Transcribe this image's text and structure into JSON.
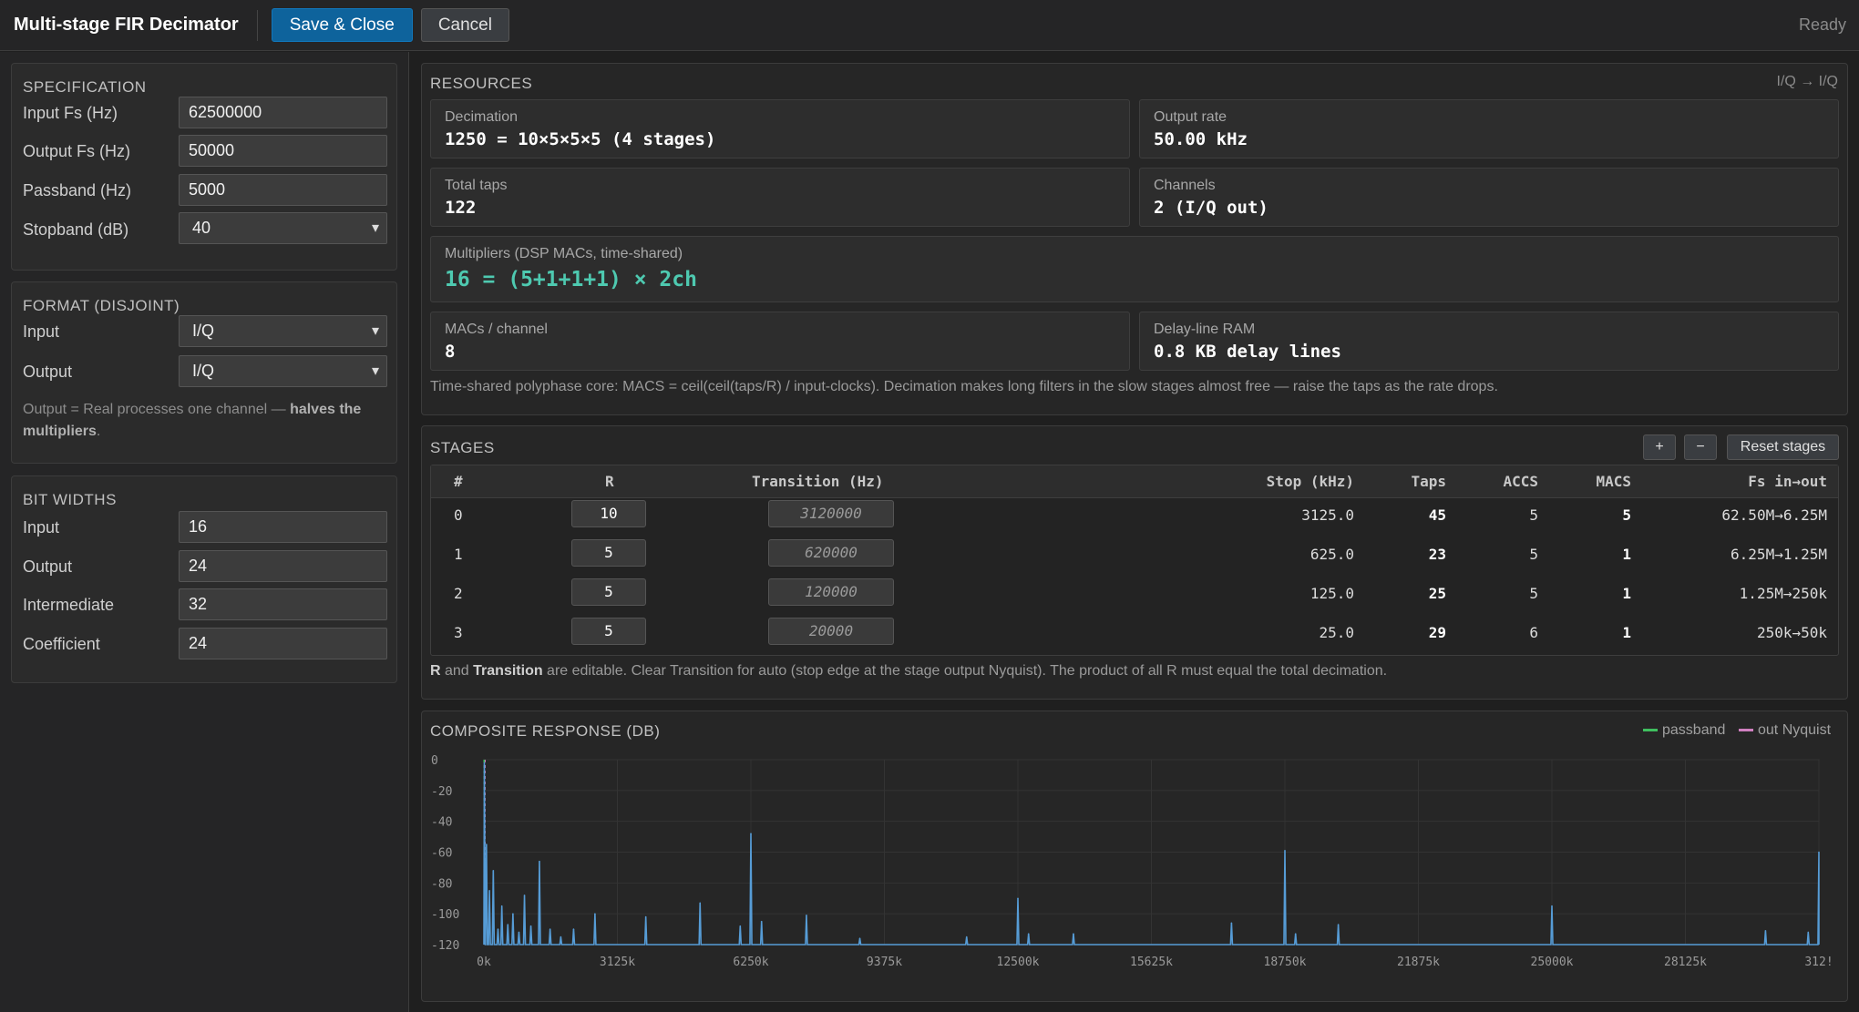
{
  "app": {
    "title": "Multi-stage FIR Decimator",
    "save_label": "Save & Close",
    "cancel_label": "Cancel",
    "status": "Ready"
  },
  "specification": {
    "title": "SPECIFICATION",
    "rows": [
      {
        "label": "Input Fs (Hz)",
        "value": "62500000"
      },
      {
        "label": "Output Fs (Hz)",
        "value": "50000"
      },
      {
        "label": "Passband (Hz)",
        "value": "5000"
      },
      {
        "label": "Stopband (dB)",
        "value": "40"
      }
    ]
  },
  "format": {
    "title": "FORMAT (DISJOINT)",
    "input_label": "Input",
    "input_value": "I/Q",
    "output_label": "Output",
    "output_value": "I/Q",
    "note_a": "Output = Real processes one channel — ",
    "note_b": "halves the multipliers",
    "note_c": "."
  },
  "bitwidths": {
    "title": "BIT WIDTHS",
    "rows": [
      {
        "label": "Input",
        "value": "16"
      },
      {
        "label": "Output",
        "value": "24"
      },
      {
        "label": "Intermediate",
        "value": "32"
      },
      {
        "label": "Coefficient",
        "value": "24"
      }
    ]
  },
  "resources": {
    "title": "RESOURCES",
    "tag": "I/Q → I/Q",
    "decimation_label": "Decimation",
    "decimation_value": "1250 = 10×5×5×5 (4 stages)",
    "output_rate_label": "Output rate",
    "output_rate_value": "50.00 kHz",
    "total_taps_label": "Total taps",
    "total_taps_value": "122",
    "channels_label": "Channels",
    "channels_value": "2 (I/Q out)",
    "multipliers_label": "Multipliers (DSP MACs, time-shared)",
    "multipliers_value": "16 = (5+1+1+1) × 2ch",
    "macs_label": "MACs / channel",
    "macs_value": "8",
    "ram_label": "Delay-line RAM",
    "ram_value": "0.8 KB delay lines",
    "caption": "Time-shared polyphase core: MACS = ceil(ceil(taps/R) / input-clocks). Decimation makes long filters in the slow stages almost free — raise the taps as the rate drops."
  },
  "stages": {
    "title": "STAGES",
    "add_label": "+",
    "remove_label": "−",
    "reset_label": "Reset stages",
    "headers": {
      "idx": "#",
      "r": "R",
      "transition": "Transition (Hz)",
      "stop": "Stop (kHz)",
      "taps": "Taps",
      "accs": "ACCS",
      "macs": "MACS",
      "fs": "Fs in→out"
    },
    "rows": [
      {
        "idx": "0",
        "r": "10",
        "transition": "3120000",
        "stop": "3125.0",
        "taps": "45",
        "accs": "5",
        "macs": "5",
        "fs": "62.50M→6.25M"
      },
      {
        "idx": "1",
        "r": "5",
        "transition": "620000",
        "stop": "625.0",
        "taps": "23",
        "accs": "5",
        "macs": "1",
        "fs": "6.25M→1.25M"
      },
      {
        "idx": "2",
        "r": "5",
        "transition": "120000",
        "stop": "125.0",
        "taps": "25",
        "accs": "5",
        "macs": "1",
        "fs": "1.25M→250k"
      },
      {
        "idx": "3",
        "r": "5",
        "transition": "20000",
        "stop": "25.0",
        "taps": "29",
        "accs": "6",
        "macs": "1",
        "fs": "250k→50k"
      }
    ],
    "caption_r": "R",
    "caption_and": " and ",
    "caption_t": "Transition",
    "caption_rest": " are editable. Clear Transition for auto (stop edge at the stage output Nyquist). The product of all R must equal the total decimation."
  },
  "chart_data": {
    "type": "line",
    "title": "COMPOSITE RESPONSE (DB)",
    "legend": [
      {
        "name": "passband",
        "color": "#3fbf5f"
      },
      {
        "name": "out Nyquist",
        "color": "#d080c0"
      }
    ],
    "line_color": "#569cd6",
    "xlim": [
      0,
      31250
    ],
    "ylim": [
      -120,
      0
    ],
    "y_ticks": [
      "0",
      "-20",
      "-40",
      "-60",
      "-80",
      "-100",
      "-120"
    ],
    "x_ticks": [
      "0k",
      "3125k",
      "6250k",
      "9375k",
      "12500k",
      "15625k",
      "18750k",
      "21875k",
      "25000k",
      "28125k",
      "312!"
    ],
    "baseline": -120,
    "peaks": [
      {
        "x": 10,
        "y": -2
      },
      {
        "x": 60,
        "y": -55
      },
      {
        "x": 130,
        "y": -85
      },
      {
        "x": 220,
        "y": -72
      },
      {
        "x": 330,
        "y": -110
      },
      {
        "x": 420,
        "y": -95
      },
      {
        "x": 560,
        "y": -107
      },
      {
        "x": 680,
        "y": -100
      },
      {
        "x": 820,
        "y": -112
      },
      {
        "x": 950,
        "y": -88
      },
      {
        "x": 1100,
        "y": -108
      },
      {
        "x": 1300,
        "y": -66
      },
      {
        "x": 1550,
        "y": -110
      },
      {
        "x": 1800,
        "y": -115
      },
      {
        "x": 2100,
        "y": -110
      },
      {
        "x": 2600,
        "y": -100
      },
      {
        "x": 3790,
        "y": -102
      },
      {
        "x": 5060,
        "y": -93
      },
      {
        "x": 6000,
        "y": -108
      },
      {
        "x": 6250,
        "y": -48
      },
      {
        "x": 6500,
        "y": -105
      },
      {
        "x": 7550,
        "y": -101
      },
      {
        "x": 8800,
        "y": -116
      },
      {
        "x": 11300,
        "y": -115
      },
      {
        "x": 12500,
        "y": -90
      },
      {
        "x": 12750,
        "y": -113
      },
      {
        "x": 13800,
        "y": -113
      },
      {
        "x": 17500,
        "y": -106
      },
      {
        "x": 18750,
        "y": -59
      },
      {
        "x": 19000,
        "y": -113
      },
      {
        "x": 20000,
        "y": -107
      },
      {
        "x": 25000,
        "y": -95
      },
      {
        "x": 30000,
        "y": -111
      },
      {
        "x": 31000,
        "y": -112
      },
      {
        "x": 31250,
        "y": -60
      }
    ]
  }
}
